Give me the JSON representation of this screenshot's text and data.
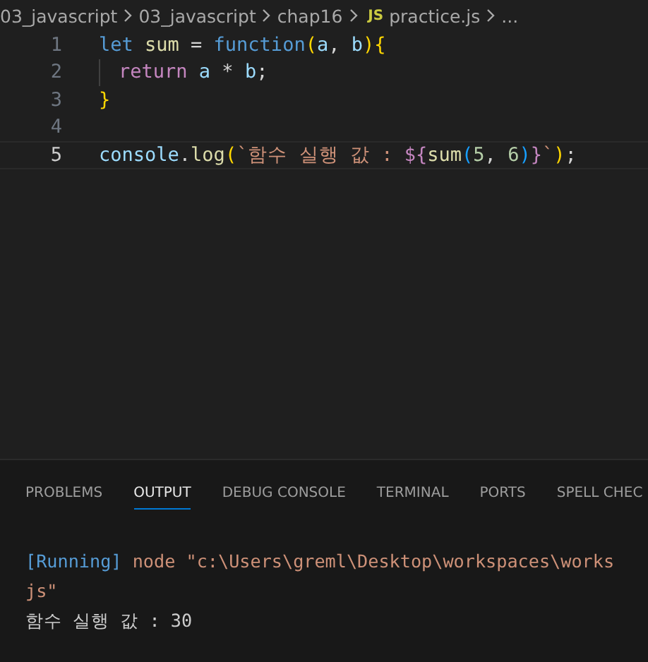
{
  "breadcrumb": [
    {
      "kind": "folder",
      "text": "03_javascript"
    },
    {
      "kind": "folder",
      "text": "03_javascript"
    },
    {
      "kind": "folder",
      "text": "chap16"
    },
    {
      "kind": "file",
      "badge": "JS",
      "text": "practice.js"
    },
    {
      "kind": "more",
      "text": "..."
    }
  ],
  "editor": {
    "lines": [
      {
        "number": "1",
        "current": false,
        "indent_guide": false,
        "tokens": [
          {
            "kind": "keyword",
            "text": "let "
          },
          {
            "kind": "function",
            "text": "sum"
          },
          {
            "kind": "plain",
            "text": " = "
          },
          {
            "kind": "keyword",
            "text": "function"
          },
          {
            "kind": "bracket1",
            "text": "("
          },
          {
            "kind": "variable",
            "text": "a"
          },
          {
            "kind": "plain",
            "text": ", "
          },
          {
            "kind": "variable",
            "text": "b"
          },
          {
            "kind": "bracket1",
            "text": ")"
          },
          {
            "kind": "bracket1",
            "text": "{"
          }
        ]
      },
      {
        "number": "2",
        "current": false,
        "indent_guide": true,
        "tokens": [
          {
            "kind": "control",
            "text": "return "
          },
          {
            "kind": "variable",
            "text": "a"
          },
          {
            "kind": "plain",
            "text": " * "
          },
          {
            "kind": "variable",
            "text": "b"
          },
          {
            "kind": "plain",
            "text": ";"
          }
        ]
      },
      {
        "number": "3",
        "current": false,
        "indent_guide": false,
        "tokens": [
          {
            "kind": "bracket1",
            "text": "}"
          }
        ]
      },
      {
        "number": "4",
        "current": false,
        "indent_guide": false
      },
      {
        "number": "5",
        "current": true,
        "indent_guide": false,
        "tokens": [
          {
            "kind": "variable",
            "text": "console"
          },
          {
            "kind": "plain",
            "text": "."
          },
          {
            "kind": "function",
            "text": "log"
          },
          {
            "kind": "bracket1",
            "text": "("
          },
          {
            "kind": "string",
            "text": "`함수 실행 값 : "
          },
          {
            "kind": "template",
            "text": "${"
          },
          {
            "kind": "function",
            "text": "sum"
          },
          {
            "kind": "bracket3",
            "text": "("
          },
          {
            "kind": "number",
            "text": "5"
          },
          {
            "kind": "plain",
            "text": ", "
          },
          {
            "kind": "number",
            "text": "6"
          },
          {
            "kind": "bracket3",
            "text": ")"
          },
          {
            "kind": "template",
            "text": "}"
          },
          {
            "kind": "string",
            "text": "`"
          },
          {
            "kind": "bracket1",
            "text": ")"
          },
          {
            "kind": "plain",
            "text": ";"
          }
        ]
      }
    ]
  },
  "panel": {
    "tabs": [
      {
        "label": "PROBLEMS",
        "selected": false
      },
      {
        "label": "OUTPUT",
        "selected": true
      },
      {
        "label": "DEBUG CONSOLE",
        "selected": false
      },
      {
        "label": "TERMINAL",
        "selected": false
      },
      {
        "label": "PORTS",
        "selected": false
      },
      {
        "label": "SPELL CHEC",
        "selected": false
      }
    ],
    "output": [
      [
        {
          "kind": "running",
          "text": "[Running]"
        },
        {
          "kind": "path",
          "text": " node \"c:\\Users\\greml\\Desktop\\workspaces\\works"
        }
      ],
      [
        {
          "kind": "path",
          "text": "js\""
        }
      ],
      [
        {
          "kind": "plain",
          "text": "함수 실행 값 : 30"
        }
      ]
    ]
  }
}
